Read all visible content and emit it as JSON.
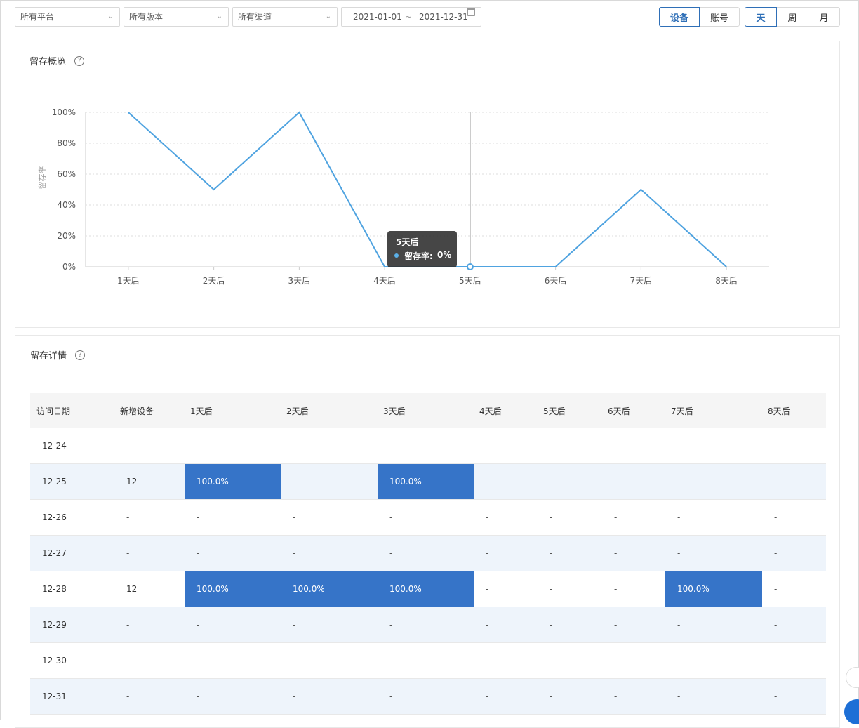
{
  "filters": {
    "platform": "所有平台",
    "version": "所有版本",
    "channel": "所有渠道",
    "date_start": "2021-01-01",
    "date_sep": "~",
    "date_end": "2021-12-31"
  },
  "toggles": {
    "subject": [
      {
        "label": "设备",
        "active": true
      },
      {
        "label": "账号",
        "active": false
      }
    ],
    "period": [
      {
        "label": "天",
        "active": true
      },
      {
        "label": "周",
        "active": false
      },
      {
        "label": "月",
        "active": false
      }
    ]
  },
  "overview": {
    "title": "留存概览",
    "help": "?"
  },
  "chart_data": {
    "type": "line",
    "categories": [
      "1天后",
      "2天后",
      "3天后",
      "4天后",
      "5天后",
      "6天后",
      "7天后",
      "8天后"
    ],
    "series": [
      {
        "name": "留存率",
        "values": [
          100,
          50,
          100,
          0,
          0,
          0,
          50,
          0
        ],
        "color": "#4fa3e0"
      }
    ],
    "ylabel": "留存率",
    "ylim": [
      0,
      100
    ],
    "yticks": [
      "0%",
      "20%",
      "40%",
      "60%",
      "80%",
      "100%"
    ],
    "grid": true,
    "tooltip": {
      "title": "5天后",
      "label": "留存率:",
      "value": "0%",
      "index": 4
    }
  },
  "detail": {
    "title": "留存详情",
    "help": "?",
    "columns": [
      "访问日期",
      "新增设备",
      "1天后",
      "2天后",
      "3天后",
      "4天后",
      "5天后",
      "6天后",
      "7天后",
      "8天后"
    ],
    "rows": [
      [
        "12-24",
        "-",
        "-",
        "-",
        "-",
        "-",
        "-",
        "-",
        "-",
        "-"
      ],
      [
        "12-25",
        "12",
        "100.0%",
        "-",
        "100.0%",
        "-",
        "-",
        "-",
        "-",
        "-"
      ],
      [
        "12-26",
        "-",
        "-",
        "-",
        "-",
        "-",
        "-",
        "-",
        "-",
        "-"
      ],
      [
        "12-27",
        "-",
        "-",
        "-",
        "-",
        "-",
        "-",
        "-",
        "-",
        "-"
      ],
      [
        "12-28",
        "12",
        "100.0%",
        "100.0%",
        "100.0%",
        "-",
        "-",
        "-",
        "100.0%",
        "-"
      ],
      [
        "12-29",
        "-",
        "-",
        "-",
        "-",
        "-",
        "-",
        "-",
        "-",
        "-"
      ],
      [
        "12-30",
        "-",
        "-",
        "-",
        "-",
        "-",
        "-",
        "-",
        "-",
        "-"
      ],
      [
        "12-31",
        "-",
        "-",
        "-",
        "-",
        "-",
        "-",
        "-",
        "-",
        "-"
      ]
    ],
    "highlight_color": "#3674c8"
  }
}
